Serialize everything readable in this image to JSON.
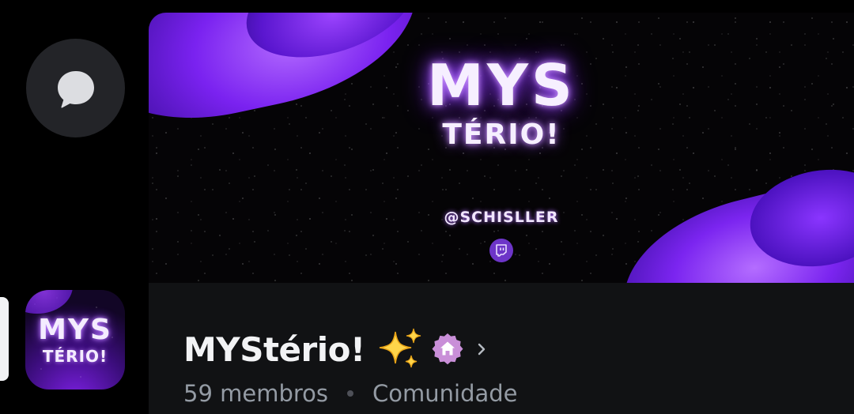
{
  "rail": {
    "dm_icon": "chat-bubble-icon",
    "server_icon": {
      "logo_top": "MYS",
      "logo_bottom": "TÉRIO!"
    }
  },
  "banner": {
    "logo_top": "MYS",
    "logo_bottom": "TÉRIO!",
    "handle": "@SCHISLLER",
    "platform_icon": "twitch-icon"
  },
  "server": {
    "name": "MYStério!",
    "emoji_icon": "sparkles-icon",
    "badge_icon": "community-home-badge-icon",
    "members": "59 membros",
    "type": "Comunidade"
  },
  "colors": {
    "background": "#000000",
    "panel": "#111214",
    "dm_button": "#232428",
    "accent_purple": "#7a22f0",
    "badge_pink": "#c98fd8",
    "muted_text": "#949ba4"
  }
}
